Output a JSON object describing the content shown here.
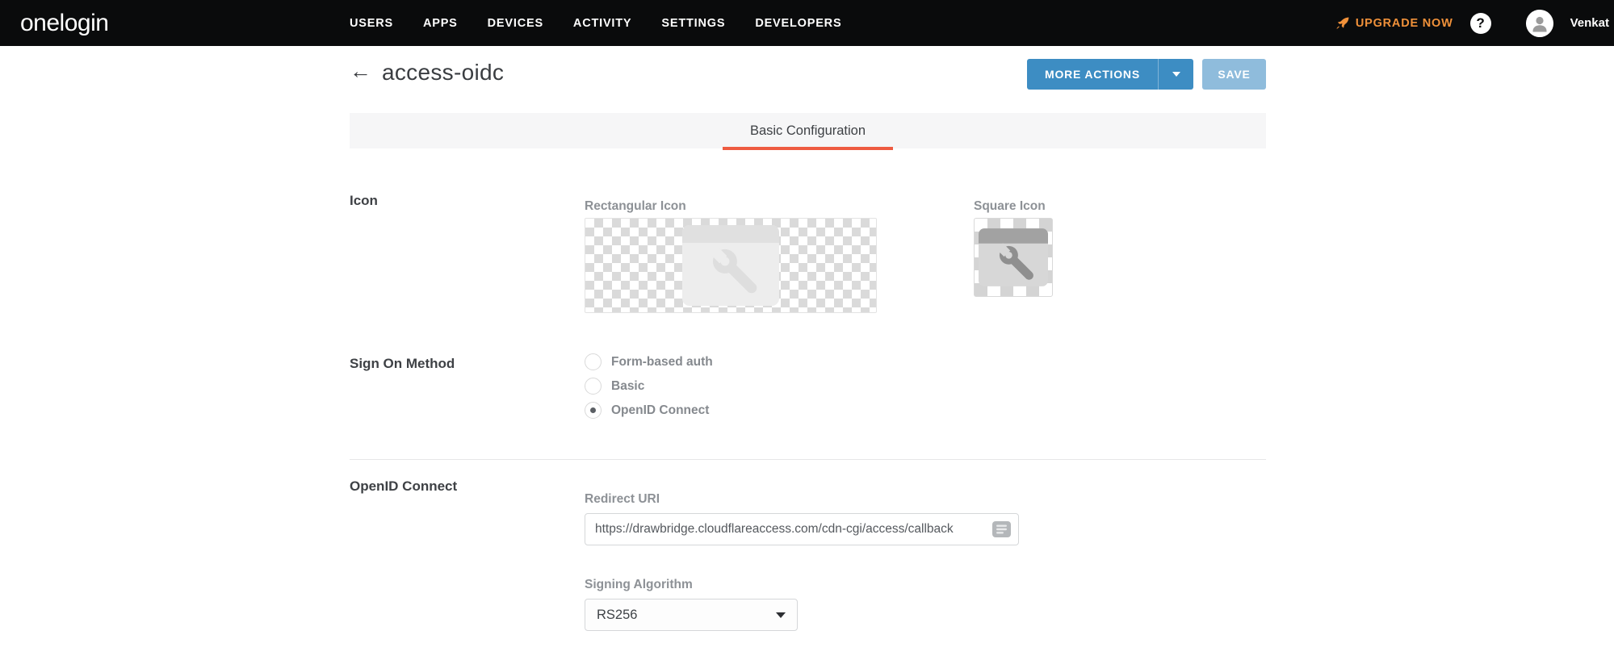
{
  "brand": {
    "logo": "onelogin"
  },
  "nav": {
    "items": [
      "USERS",
      "APPS",
      "DEVICES",
      "ACTIVITY",
      "SETTINGS",
      "DEVELOPERS"
    ]
  },
  "account": {
    "upgrade_label": "UPGRADE NOW",
    "help_glyph": "?",
    "username": "Venkat"
  },
  "page_header": {
    "back_arrow": "←",
    "title": "access-oidc",
    "more_actions_label": "MORE ACTIONS",
    "save_label": "SAVE"
  },
  "tabs": {
    "basic_configuration": "Basic Configuration"
  },
  "form": {
    "icon": {
      "section_label": "Icon",
      "rectangular_label": "Rectangular Icon",
      "square_label": "Square Icon"
    },
    "sign_on": {
      "section_label": "Sign On Method",
      "options": [
        {
          "label": "Form-based auth",
          "selected": false
        },
        {
          "label": "Basic",
          "selected": false
        },
        {
          "label": "OpenID Connect",
          "selected": true
        }
      ]
    },
    "oidc": {
      "section_label": "OpenID Connect",
      "redirect_uri": {
        "label": "Redirect URI",
        "value": "https://drawbridge.cloudflareaccess.com/cdn-cgi/access/callback"
      },
      "signing_algorithm": {
        "label": "Signing Algorithm",
        "value": "RS256"
      }
    }
  },
  "colors": {
    "navbar_bg": "#0a0b0c",
    "accent_blue": "#3d8dc3",
    "save_disabled_blue": "#8fbcdc",
    "upgrade_orange": "#f0913a",
    "tab_underline_red": "#ee5b41"
  }
}
